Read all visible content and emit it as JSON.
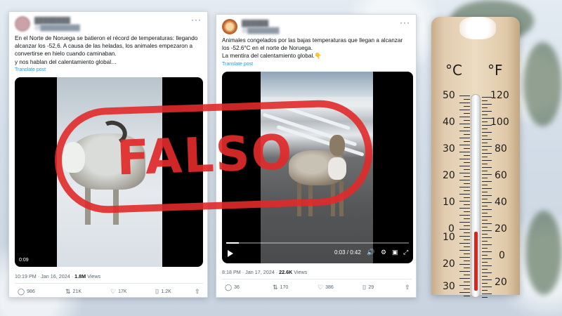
{
  "tweets": [
    {
      "body_lines": [
        "En el Norte de Noruega se batieron el récord de temperaturas: llegando",
        "alcanzar los -52,6. A causa de las heladas, los animales empezaron a",
        "convertirse en hielo cuando caminaban.",
        "y nos hablan del calentamiento global…"
      ],
      "translate": "Translate post",
      "video_time": "0:09",
      "time": "10:19 PM · Jan 16, 2024 ·",
      "views_count": "1.8M",
      "views_label": "Views",
      "replies": "986",
      "reposts": "21K",
      "likes": "17K",
      "bookmarks": "1.2K"
    },
    {
      "body_lines": [
        "Animales congelados por  las bajas temperaturas que llegan a alcanzar",
        "los -52.6°C en el norte de Noruega.",
        "La mentira del calentamiento global.👇"
      ],
      "translate": "Translate post",
      "video_time": "0:03 / 0:42",
      "video_progress": 0.07,
      "time": "8:18 PM · Jan 17, 2024 ·",
      "views_count": "22.6K",
      "views_label": "Views",
      "replies": "36",
      "reposts": "170",
      "likes": "386",
      "bookmarks": "29"
    }
  ],
  "thermometer": {
    "unit_c": "°C",
    "unit_f": "°F",
    "celsius": [
      "50",
      "40",
      "30",
      "20",
      "10",
      "0",
      "10",
      "20",
      "30"
    ],
    "fahrenheit": [
      "120",
      "100",
      "80",
      "60",
      "40",
      "20",
      "0",
      "20"
    ],
    "mercury_color": "#d7261e"
  },
  "stamp": {
    "text": "FALSO",
    "color": "#e12a2a"
  }
}
